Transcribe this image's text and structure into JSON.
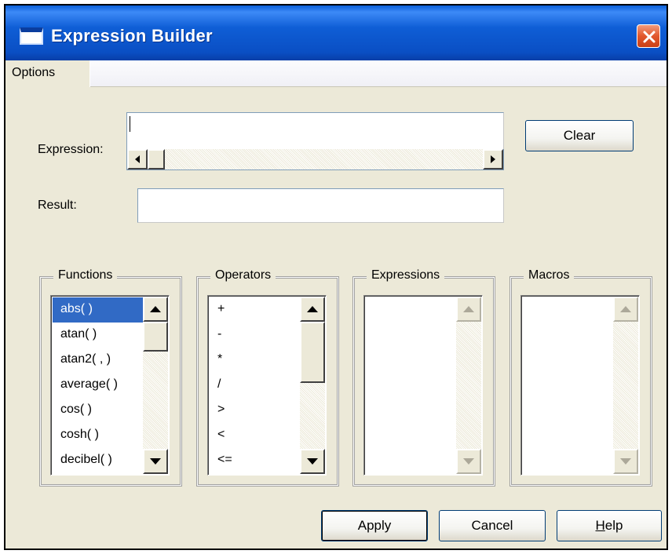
{
  "window": {
    "title": "Expression Builder"
  },
  "menu": {
    "options": "Options"
  },
  "expression": {
    "label": "Expression:",
    "value": ""
  },
  "result": {
    "label": "Result:",
    "value": ""
  },
  "buttons": {
    "clear": "Clear",
    "apply": "Apply",
    "cancel": "Cancel",
    "help": "Help",
    "help_mnemonic": "H",
    "help_rest": "elp"
  },
  "groups": {
    "functions": {
      "title": "Functions",
      "items": [
        "abs( )",
        "atan( )",
        "atan2( , )",
        "average( )",
        "cos( )",
        "cosh( )",
        "decibel( )"
      ],
      "selected": "abs( )"
    },
    "operators": {
      "title": "Operators",
      "items": [
        "+",
        "-",
        "*",
        "/",
        ">",
        "<",
        "<="
      ]
    },
    "expressions": {
      "title": "Expressions",
      "items": []
    },
    "macros": {
      "title": "Macros",
      "items": []
    }
  },
  "colors": {
    "selection": "#316ac5",
    "titlebar": "#0a5fd8",
    "face": "#ece9d8"
  }
}
